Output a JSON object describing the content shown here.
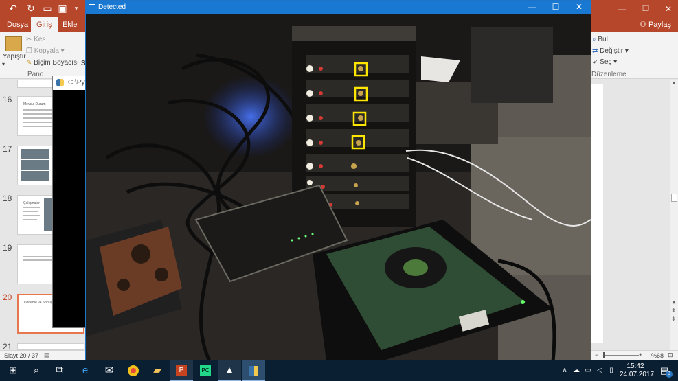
{
  "powerpoint": {
    "tabs": [
      "Dosya",
      "Giriş",
      "Ekle"
    ],
    "share_label": "Paylaş",
    "ribbon": {
      "paste_label": "Yapıştır",
      "cut_label": "Kes",
      "copy_label": "Kopyala",
      "format_painter_label": "Biçim Boyacısı",
      "clipboard_group": "Pano",
      "find_label": "Bul",
      "replace_label": "Değiştir",
      "select_label": "Seç",
      "editing_group": "Düzenleme",
      "s_fragment": "S"
    },
    "slides": [
      {
        "number": "16",
        "title": "Mevcut Durum"
      },
      {
        "number": "17",
        "title": ""
      },
      {
        "number": "18",
        "title": "Çalışmalar"
      },
      {
        "number": "19",
        "title": ""
      },
      {
        "number": "20",
        "title": "Deneme ve Sonuç"
      },
      {
        "number": "21",
        "title": ""
      }
    ],
    "status": {
      "slide_counter": "Slayt 20 / 37",
      "zoom": "%68",
      "zoom_minus": "−",
      "zoom_plus": "+"
    }
  },
  "console": {
    "title": "C:\\Pyth"
  },
  "detected_window": {
    "title": "Detected",
    "minimize": "—",
    "maximize": "☐",
    "close": "✕",
    "detection_count": 4
  },
  "taskbar": {
    "time": "15:42",
    "date": "24.07.2017",
    "notification_count": "3",
    "apps": [
      "start",
      "search",
      "task-view",
      "edge",
      "mail",
      "chrome",
      "file-explorer",
      "powerpoint",
      "pycharm",
      "photos",
      "python"
    ]
  }
}
